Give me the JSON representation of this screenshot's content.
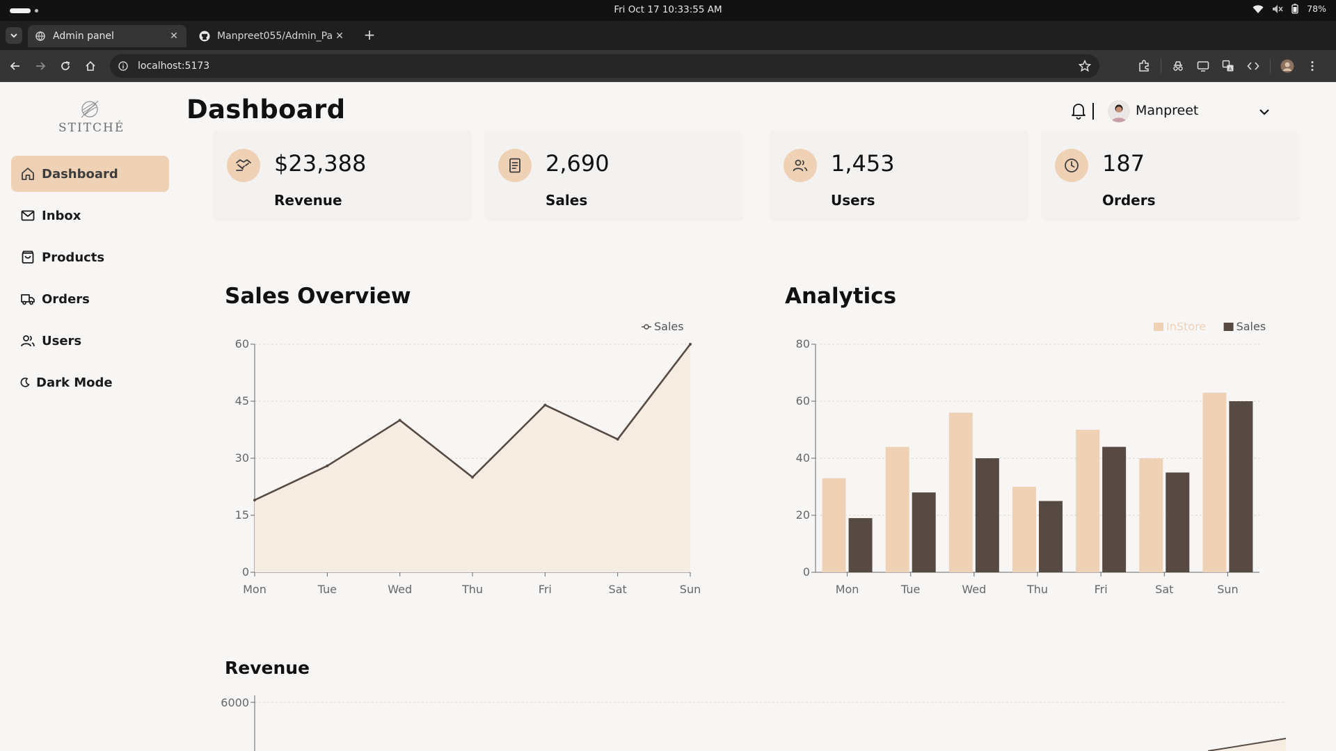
{
  "system_bar": {
    "clock": "Fri Oct 17  10:33:55 AM",
    "battery": "78%"
  },
  "browser": {
    "tabs": [
      {
        "label": "Admin panel",
        "active": true,
        "icon": "globe-icon"
      },
      {
        "label": "Manpreet055/Admin_Pa",
        "active": false,
        "icon": "github-icon"
      }
    ],
    "url": "localhost:5173"
  },
  "app": {
    "brand": "STITCHÉ",
    "title": "Dashboard",
    "user_name": "Manpreet",
    "colors": {
      "accent": "#efd2b5",
      "dark": "#574a42",
      "area": "#f5ece2"
    },
    "sidebar": [
      {
        "label": "Dashboard",
        "icon": "home-icon",
        "active": true
      },
      {
        "label": "Inbox",
        "icon": "mail-icon",
        "active": false
      },
      {
        "label": "Products",
        "icon": "shopping-bag-icon",
        "active": false
      },
      {
        "label": "Orders",
        "icon": "truck-icon",
        "active": false
      },
      {
        "label": "Users",
        "icon": "users-icon",
        "active": false
      },
      {
        "label": "Dark Mode",
        "icon": "moon-icon",
        "active": false
      }
    ],
    "stats": [
      {
        "value": "$23,388",
        "label": "Revenue",
        "icon": "handshake-icon"
      },
      {
        "value": "2,690",
        "label": "Sales",
        "icon": "receipt-icon"
      },
      {
        "value": "1,453",
        "label": "Users",
        "icon": "users-icon"
      },
      {
        "value": "187",
        "label": "Orders",
        "icon": "clock-icon"
      }
    ],
    "sections": {
      "sales_overview": "Sales Overview",
      "analytics": "Analytics",
      "revenue": "Revenue"
    }
  },
  "chart_data": [
    {
      "type": "area",
      "title": "Sales Overview",
      "categories": [
        "Mon",
        "Tue",
        "Wed",
        "Thu",
        "Fri",
        "Sat",
        "Sun"
      ],
      "series": [
        {
          "name": "Sales",
          "values": [
            19,
            28,
            40,
            25,
            44,
            35,
            60
          ]
        }
      ],
      "ylim": [
        0,
        60
      ],
      "yticks": [
        0,
        15,
        30,
        45,
        60
      ],
      "grid": true,
      "legend": "top-right"
    },
    {
      "type": "bar",
      "title": "Analytics",
      "categories": [
        "Mon",
        "Tue",
        "Wed",
        "Thu",
        "Fri",
        "Sat",
        "Sun"
      ],
      "series": [
        {
          "name": "InStore",
          "values": [
            33,
            44,
            56,
            30,
            50,
            40,
            63
          ]
        },
        {
          "name": "Sales",
          "values": [
            19,
            28,
            40,
            25,
            44,
            35,
            60
          ]
        }
      ],
      "ylim": [
        0,
        80
      ],
      "yticks": [
        0,
        20,
        40,
        60,
        80
      ],
      "grid": true,
      "legend": "top-right"
    },
    {
      "type": "area",
      "title": "Revenue",
      "yticks": [
        6000
      ],
      "grid": true
    }
  ]
}
